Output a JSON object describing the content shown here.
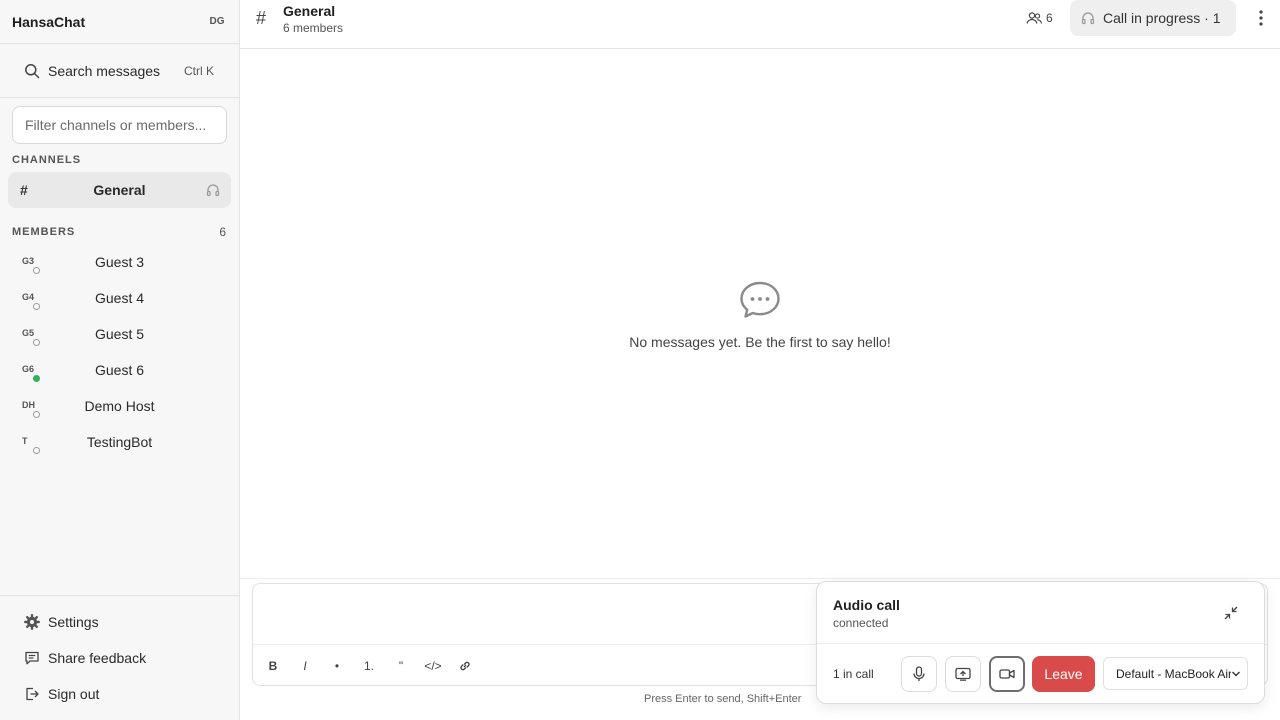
{
  "app": {
    "name": "HansaChat",
    "user_initials": "DG"
  },
  "search": {
    "label": "Search messages",
    "shortcut": "Ctrl K"
  },
  "filter": {
    "placeholder": "Filter channels or members..."
  },
  "channels": {
    "title": "CHANNELS",
    "items": [
      {
        "hash": "#",
        "name": "General",
        "icon": "headphones-icon"
      }
    ]
  },
  "members": {
    "title": "MEMBERS",
    "count": "6",
    "items": [
      {
        "initials": "G3",
        "name": "Guest 3",
        "status": "offline"
      },
      {
        "initials": "G4",
        "name": "Guest 4",
        "status": "offline"
      },
      {
        "initials": "G5",
        "name": "Guest 5",
        "status": "offline"
      },
      {
        "initials": "G6",
        "name": "Guest 6",
        "status": "online"
      },
      {
        "initials": "DH",
        "name": "Demo Host",
        "status": "offline"
      },
      {
        "initials": "T",
        "name": "TestingBot",
        "status": "offline"
      }
    ]
  },
  "footer": {
    "settings": "Settings",
    "feedback": "Share feedback",
    "signout": "Sign out"
  },
  "header": {
    "hash": "#",
    "title": "General",
    "subtitle": "6 members",
    "member_count": "6",
    "call_status": "Call in progress · 1"
  },
  "empty_state": {
    "text": "No messages yet. Be the first to say hello!"
  },
  "composer": {
    "hint": "Press Enter to send, Shift+Enter",
    "tools": {
      "bold": "B",
      "italic": "I",
      "bullet": "•",
      "ordered": "1.",
      "quote": "\"",
      "code": "</>"
    }
  },
  "call_panel": {
    "title": "Audio call",
    "status": "connected",
    "count": "1 in call",
    "leave": "Leave",
    "device": "Default - MacBook Air"
  },
  "colors": {
    "leave": "#d94a4a",
    "online": "#2fb35a",
    "active_channel": "#e9e9e9"
  }
}
